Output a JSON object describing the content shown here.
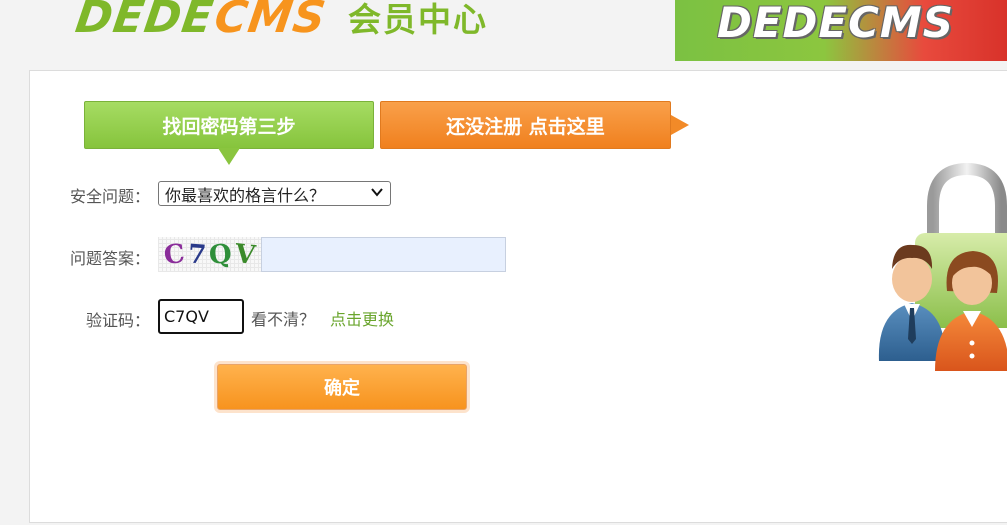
{
  "header": {
    "logo_dede": "DEDE",
    "logo_cms": "CMS",
    "logo_sub": "会员中心",
    "banner_text": "DEDECMS"
  },
  "tabs": {
    "step": "找回密码第三步",
    "register": "还没注册 点击这里"
  },
  "form": {
    "question_label": "安全问题：",
    "question_selected": "你最喜欢的格言什么？",
    "answer_label": "问题答案：",
    "captcha_chars": [
      "C",
      "7",
      "Q",
      "V"
    ],
    "answer_value": "",
    "code_label": "验证码：",
    "code_value": "C7QV",
    "hint": "看不清？",
    "refresh_link": "点击更换",
    "submit": "确定"
  },
  "icons": {
    "illustration": "users-lock-icon",
    "select_arrow": "chevron-down-icon"
  },
  "colors": {
    "green": "#7fb82a",
    "orange": "#f7941d",
    "link": "#6aa52d",
    "input_fill": "#e8f0fe"
  }
}
